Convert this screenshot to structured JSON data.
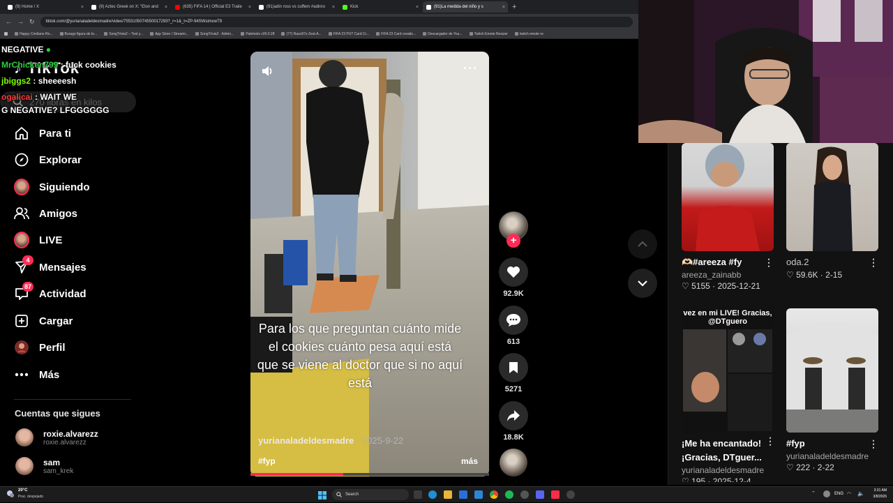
{
  "browser": {
    "tabs": [
      {
        "title": "(9) Home / X",
        "icon": "x-logo-icon",
        "color": "#ffffff"
      },
      {
        "title": "(9) Aztec Greek on X: \"Elon and",
        "icon": "x-logo-icon",
        "color": "#ffffff"
      },
      {
        "title": "(635) FIFA 14 | Official E3 Traile",
        "icon": "youtube-icon",
        "color": "#ff0000"
      },
      {
        "title": "(91)adin ross vs cuffem #adinro",
        "icon": "tiktok-icon",
        "color": "#ffffff"
      },
      {
        "title": "Kick",
        "icon": "kick-icon",
        "color": "#53fc18"
      },
      {
        "title": "(91)La medida del niño y s",
        "icon": "tiktok-icon",
        "color": "#ffffff",
        "active": true
      }
    ],
    "url": "tiktok.com/@yurianaladeldesmadre/video/7553105074550017293?_r=1&_t=ZP-94SWsimxwT9",
    "bookmarks": [
      "Happy Cristiano Ro...",
      "Burago figura de to...",
      "SongTrivia2 – Test y...",
      "App Store / Streami...",
      "SongTrivia2 - Adivin...",
      "Paletools v26.0.28",
      "(77) Razo97s Zest-A...",
      "FIFA 23 PUT Card Cr...",
      "FIFA 23 Card creatio...",
      "Descargador de You...",
      "Twitch Emote Resizer",
      "twitch emote re"
    ]
  },
  "sidebar": {
    "logo": "TikTok",
    "search_placeholder": "270 libras en kilos",
    "items": [
      {
        "label": "Para ti",
        "icon": "home-icon"
      },
      {
        "label": "Explorar",
        "icon": "compass-icon"
      },
      {
        "label": "Siguiendo",
        "icon": "following-avatar-icon"
      },
      {
        "label": "Amigos",
        "icon": "friends-icon"
      },
      {
        "label": "LIVE",
        "icon": "live-avatar-icon"
      },
      {
        "label": "Mensajes",
        "icon": "send-icon",
        "badge": "4"
      },
      {
        "label": "Actividad",
        "icon": "inbox-icon",
        "badge": "87"
      },
      {
        "label": "Cargar",
        "icon": "upload-icon"
      },
      {
        "label": "Perfil",
        "icon": "profile-avatar-icon"
      },
      {
        "label": "Más",
        "icon": "more-dots-icon"
      }
    ],
    "following_header": "Cuentas que sigues",
    "following": [
      {
        "name": "roxie.alvarezz",
        "handle": "roxie.alvarezz"
      },
      {
        "name": "sam",
        "handle": "sam_krek"
      }
    ]
  },
  "chat": [
    {
      "user": "",
      "text": "NEGATIVE",
      "color": "#ffffff"
    },
    {
      "user": "MrChicken799",
      "text": "fuck cookies",
      "color": "#2ecc40"
    },
    {
      "user": "jbiggs2",
      "text": "sheeeesh",
      "color": "#7fff00"
    },
    {
      "user": "ogalicai",
      "text": "WAIT WE",
      "color": "#ff3b3b"
    },
    {
      "user": "",
      "text": "G NEGATIVE? LFGGGGGG",
      "color": "#ffffff"
    }
  ],
  "video": {
    "caption": "Para los que preguntan cuánto mide el cookies cuánto pesa aquí está que se viene al doctor que si no aquí está",
    "author": "yurianaladeldesmadre",
    "date": "2025-9-22",
    "hashtag": "#fyp",
    "more": "más",
    "progress": 0.39
  },
  "actions": {
    "likes": "92.9K",
    "comments": "613",
    "saves": "5271",
    "shares": "18.8K"
  },
  "recommendations": [
    {
      "title": "🫶🏻#areeza #fy",
      "author": "areeza_zainabb",
      "likes": "5155",
      "date": "2025-12-21"
    },
    {
      "title": "oda.2",
      "author": "",
      "likes": "59.6K",
      "date": "2-15"
    },
    {
      "title": "¡Me ha encantado! ¡Gracias, DTguer...",
      "author": "yurianaladeldesmadre",
      "likes": "195",
      "date": "2025-12-4",
      "thumb_text": "vez en mi LIVE! Gracias, @DTguero"
    },
    {
      "title": "#fyp",
      "author": "yurianaladeldesmadre",
      "likes": "222",
      "date": "2-22"
    }
  ],
  "taskbar": {
    "weather_temp": "20°C",
    "weather_desc": "Prac. despejado",
    "search": "Search",
    "lang": "ENG",
    "time": "3:31 AM",
    "date": "3/8/2026"
  }
}
